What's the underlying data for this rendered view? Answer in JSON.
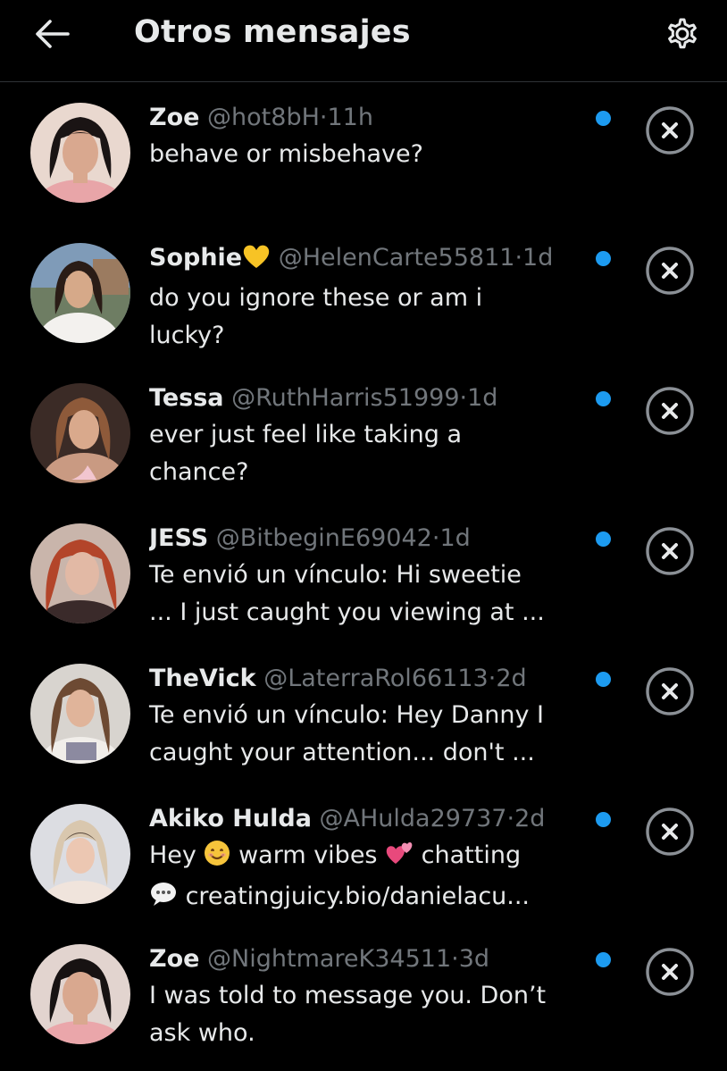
{
  "colors": {
    "background": "#000000",
    "text_primary": "#e7e9ea",
    "text_secondary": "#71767b",
    "accent_unread": "#1d9bf0",
    "icon": "#e7e9ea",
    "dismiss_icon": "#8b9096"
  },
  "header": {
    "back_icon": "arrow-left-icon",
    "title": "Otros mensajes",
    "settings_icon": "gear-icon"
  },
  "messages": [
    {
      "name": "Zoe",
      "name_emoji": "",
      "handle": "@hot8bH",
      "separator": "·",
      "time": "11h",
      "lines": [
        "behave or misbehave?"
      ],
      "unread": true,
      "avatar_icon": "avatar-photo"
    },
    {
      "name": "Sophie",
      "name_emoji": "yellow-heart-emoji",
      "handle": "@HelenCarte55811",
      "separator": "·",
      "time": "1d",
      "lines": [
        "do you ignore these or am i",
        "lucky?"
      ],
      "unread": true,
      "avatar_icon": "avatar-photo"
    },
    {
      "name": "Tessa",
      "name_emoji": "",
      "handle": "@RuthHarris51999",
      "separator": "·",
      "time": "1d",
      "lines": [
        "ever just feel like taking a",
        "chance?"
      ],
      "unread": true,
      "avatar_icon": "avatar-photo"
    },
    {
      "name": "JESS",
      "name_emoji": "",
      "handle": "@BitbeginE69042",
      "separator": "·",
      "time": "1d",
      "lines": [
        "Te envió un vínculo: Hi sweetie",
        "... I just caught you viewing at ..."
      ],
      "unread": true,
      "avatar_icon": "avatar-photo"
    },
    {
      "name": "TheVick",
      "name_emoji": "",
      "handle": "@LaterraRol66113",
      "separator": "·",
      "time": "2d",
      "lines": [
        "Te envió un vínculo: Hey Danny I",
        "caught your attention... don't ..."
      ],
      "unread": true,
      "avatar_icon": "avatar-photo"
    },
    {
      "name": "Akiko Hulda",
      "name_emoji": "",
      "handle": "@AHulda29737",
      "separator": "·",
      "time": "2d",
      "line1_a": "Hey ",
      "line1_b": " warm vibes ",
      "line1_c": " chatting",
      "line2": " creatingjuicy.bio/danielacu...",
      "line_emojis": [
        "smiling-face-emoji",
        "two-hearts-emoji",
        "speech-balloon-emoji"
      ],
      "unread": true,
      "avatar_icon": "avatar-photo"
    },
    {
      "name": "Zoe",
      "name_emoji": "",
      "handle": "@NightmareK34511",
      "separator": "·",
      "time": "3d",
      "lines": [
        "I was told to message you. Don’t",
        "ask who."
      ],
      "unread": true,
      "avatar_icon": "avatar-photo"
    }
  ]
}
